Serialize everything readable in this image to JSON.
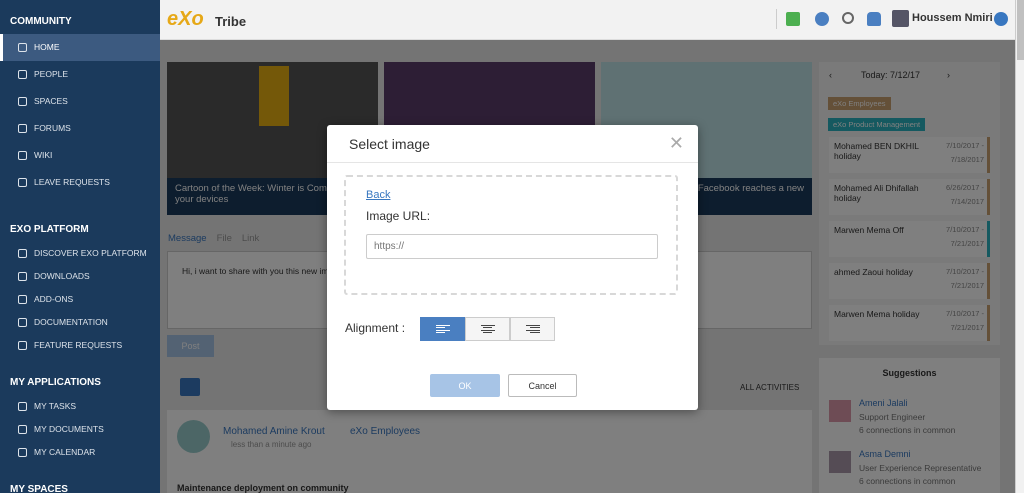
{
  "sidebar": {
    "section_community": "COMMUNITY",
    "community_items": [
      "HOME",
      "PEOPLE",
      "SPACES",
      "FORUMS",
      "WIKI",
      "LEAVE REQUESTS"
    ],
    "section_platform": "EXO PLATFORM",
    "platform_items": [
      "DISCOVER EXO PLATFORM",
      "DOWNLOADS",
      "ADD-ONS",
      "DOCUMENTATION",
      "FEATURE REQUESTS"
    ],
    "section_apps": "MY APPLICATIONS",
    "app_items": [
      "MY TASKS",
      "MY DOCUMENTS",
      "MY CALENDAR"
    ],
    "section_spaces": "MY SPACES"
  },
  "topbar": {
    "logo": "eXo",
    "space_name": "Tribe",
    "user_name": "Houssem Nmiri"
  },
  "banners": [
    {
      "caption": "Cartoon of the Week: Winter is Coming of your devices"
    },
    {
      "caption": "Facebook reaches a new"
    }
  ],
  "composer": {
    "tabs": [
      "Message",
      "File",
      "Link"
    ],
    "text": "Hi, i want to share with you this new im",
    "post_label": "Post",
    "filter_label": "ALL ACTIVITIES"
  },
  "activity": {
    "author": "Mohamed Amine Krout",
    "space": "eXo Employees",
    "time": "less than a minute ago",
    "body": "Maintenance deployment on community"
  },
  "calendar": {
    "today_label": "Today: 7/12/17",
    "tags": [
      "eXo Employees",
      "eXo Product Management"
    ],
    "events": [
      {
        "title": "Mohamed BEN DKHIL holiday",
        "start": "7/10/2017 -",
        "end": "7/18/2017"
      },
      {
        "title": "Mohamed Ali Dhifallah holiday",
        "start": "6/26/2017 -",
        "end": "7/14/2017"
      },
      {
        "title": "Marwen Mema Off",
        "start": "7/10/2017 -",
        "end": "7/21/2017"
      },
      {
        "title": "ahmed Zaoui holiday",
        "start": "7/10/2017 -",
        "end": "7/21/2017"
      },
      {
        "title": "Marwen Mema holiday",
        "start": "7/10/2017 -",
        "end": "7/21/2017"
      }
    ]
  },
  "suggestions": {
    "title": "Suggestions",
    "people": [
      {
        "name": "Ameni Jalali",
        "role": "Support Engineer",
        "connections": "6 connections in common"
      },
      {
        "name": "Asma Demni",
        "role": "User Experience Representative",
        "connections": "6 connections in common"
      }
    ]
  },
  "modal": {
    "title": "Select image",
    "back_label": "Back",
    "url_label": "Image URL:",
    "url_placeholder": "https://",
    "alignment_label": "Alignment :",
    "alignment_options": [
      "left",
      "center",
      "right"
    ],
    "alignment_selected": "left",
    "ok_label": "OK",
    "cancel_label": "Cancel"
  }
}
